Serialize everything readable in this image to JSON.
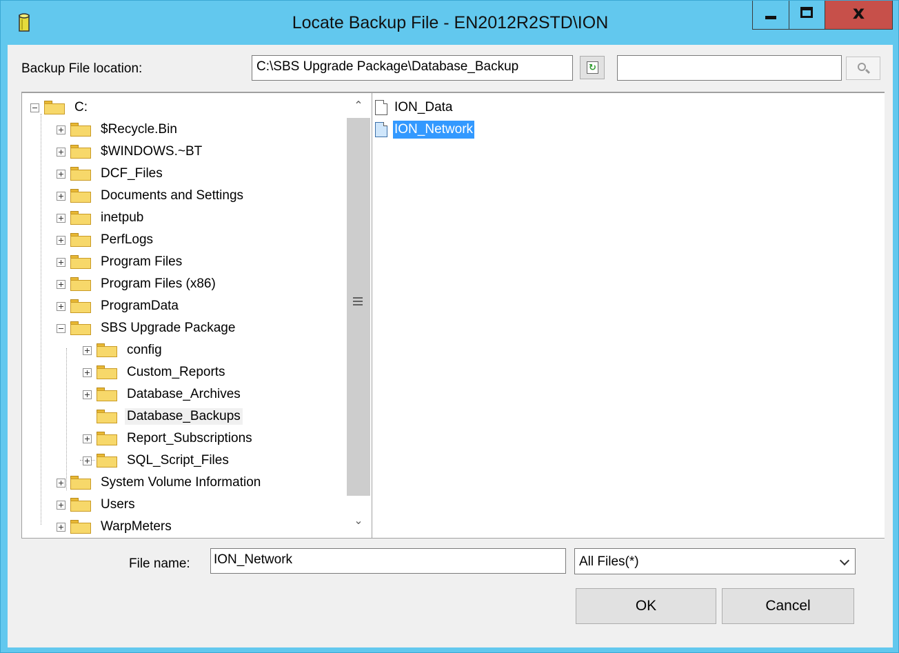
{
  "window": {
    "title": "Locate Backup File - EN2012R2STD\\ION",
    "close_glyph": "x"
  },
  "location": {
    "label": "Backup File location:",
    "path": "C:\\SBS Upgrade Package\\Database_Backup",
    "search_value": ""
  },
  "tree": {
    "root": "C:",
    "folders": [
      {
        "label": "$Recycle.Bin"
      },
      {
        "label": "$WINDOWS.~BT"
      },
      {
        "label": "DCF_Files"
      },
      {
        "label": "Documents and Settings"
      },
      {
        "label": "inetpub"
      },
      {
        "label": "PerfLogs"
      },
      {
        "label": "Program Files"
      },
      {
        "label": "Program Files (x86)"
      },
      {
        "label": "ProgramData"
      },
      {
        "label": "SBS Upgrade Package"
      },
      {
        "label": "config"
      },
      {
        "label": "Custom_Reports"
      },
      {
        "label": "Database_Archives"
      },
      {
        "label": "Database_Backups"
      },
      {
        "label": "Report_Subscriptions"
      },
      {
        "label": "SQL_Script_Files"
      },
      {
        "label": "System Volume Information"
      },
      {
        "label": "Users"
      },
      {
        "label": "WarpMeters"
      }
    ]
  },
  "files": [
    {
      "label": "ION_Data"
    },
    {
      "label": "ION_Network"
    }
  ],
  "bottom": {
    "file_name_label": "File name:",
    "file_name_value": "ION_Network",
    "filter": "All Files(*)",
    "ok_label": "OK",
    "cancel_label": "Cancel"
  }
}
